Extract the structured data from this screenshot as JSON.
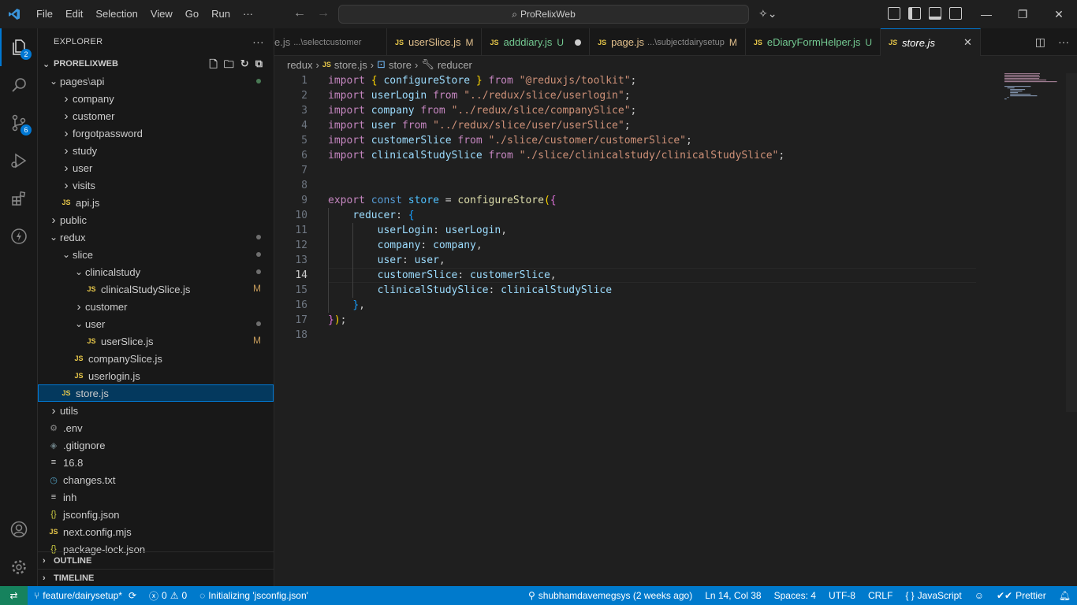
{
  "titlebar": {
    "menu": [
      "File",
      "Edit",
      "Selection",
      "View",
      "Go",
      "Run",
      "···"
    ],
    "search_text": "ProRelixWeb"
  },
  "activity": {
    "explorer_badge": "2",
    "scm_badge": "6"
  },
  "explorer": {
    "header": "EXPLORER",
    "more": "···",
    "project": "PRORELIXWEB",
    "tree": [
      {
        "label": "pages",
        "sub": "api",
        "depth": 1,
        "type": "folder-open",
        "marker": "dot-green"
      },
      {
        "label": "company",
        "depth": 2,
        "type": "folder"
      },
      {
        "label": "customer",
        "depth": 2,
        "type": "folder"
      },
      {
        "label": "forgotpassword",
        "depth": 2,
        "type": "folder"
      },
      {
        "label": "study",
        "depth": 2,
        "type": "folder"
      },
      {
        "label": "user",
        "depth": 2,
        "type": "folder"
      },
      {
        "label": "visits",
        "depth": 2,
        "type": "folder"
      },
      {
        "label": "api.js",
        "depth": 2,
        "type": "js"
      },
      {
        "label": "public",
        "depth": 1,
        "type": "folder"
      },
      {
        "label": "redux",
        "depth": 1,
        "type": "folder-open",
        "marker": "dot",
        "modified": true
      },
      {
        "label": "slice",
        "depth": 2,
        "type": "folder-open",
        "marker": "dot",
        "modified": true
      },
      {
        "label": "clinicalstudy",
        "depth": 3,
        "type": "folder-open",
        "marker": "dot",
        "modified": true
      },
      {
        "label": "clinicalStudySlice.js",
        "depth": 4,
        "type": "js",
        "marker": "M",
        "modified": true
      },
      {
        "label": "customer",
        "depth": 3,
        "type": "folder"
      },
      {
        "label": "user",
        "depth": 3,
        "type": "folder-open",
        "marker": "dot",
        "modified": true
      },
      {
        "label": "userSlice.js",
        "depth": 4,
        "type": "js",
        "marker": "M",
        "modified": true
      },
      {
        "label": "companySlice.js",
        "depth": 3,
        "type": "js"
      },
      {
        "label": "userlogin.js",
        "depth": 3,
        "type": "js"
      },
      {
        "label": "store.js",
        "depth": 2,
        "type": "js",
        "selected": true
      },
      {
        "label": "utils",
        "depth": 1,
        "type": "folder"
      },
      {
        "label": ".env",
        "depth": 1,
        "type": "gear"
      },
      {
        "label": ".gitignore",
        "depth": 1,
        "type": "git"
      },
      {
        "label": "16.8",
        "depth": 1,
        "type": "lines"
      },
      {
        "label": "changes.txt",
        "depth": 1,
        "type": "clock"
      },
      {
        "label": "inh",
        "depth": 1,
        "type": "lines"
      },
      {
        "label": "jsconfig.json",
        "depth": 1,
        "type": "json"
      },
      {
        "label": "next.config.mjs",
        "depth": 1,
        "type": "js"
      },
      {
        "label": "package-lock.json",
        "depth": 1,
        "type": "json"
      }
    ],
    "outline": "OUTLINE",
    "timeline": "TIMELINE"
  },
  "tabs": [
    {
      "name": "e.js",
      "desc": "...\\selectcustomer",
      "status": "",
      "icon": false
    },
    {
      "name": "userSlice.js",
      "desc": "",
      "status": "M",
      "icon": true,
      "color": "#e2c08d"
    },
    {
      "name": "adddiary.js",
      "desc": "",
      "status": "U",
      "icon": true,
      "color": "#73c991",
      "dot": true
    },
    {
      "name": "page.js",
      "desc": "...\\subjectdairysetup",
      "status": "M",
      "icon": true,
      "color": "#e2c08d"
    },
    {
      "name": "eDiaryFormHelper.js",
      "desc": "",
      "status": "U",
      "icon": true,
      "color": "#73c991"
    },
    {
      "name": "store.js",
      "desc": "",
      "status": "",
      "icon": true,
      "active": true
    }
  ],
  "breadcrumb": {
    "folder": "redux",
    "file": "store.js",
    "symbol": "store",
    "prop": "reducer"
  },
  "editor": {
    "current_line": 14,
    "lines": [
      [
        [
          "kw",
          "import"
        ],
        [
          "t",
          " "
        ],
        [
          "br1",
          "{"
        ],
        [
          "t",
          " "
        ],
        [
          "var",
          "configureStore"
        ],
        [
          "t",
          " "
        ],
        [
          "br1",
          "}"
        ],
        [
          "t",
          " "
        ],
        [
          "kw",
          "from"
        ],
        [
          "t",
          " "
        ],
        [
          "str",
          "\"@reduxjs/toolkit\""
        ],
        [
          "t",
          ";"
        ]
      ],
      [
        [
          "kw",
          "import"
        ],
        [
          "t",
          " "
        ],
        [
          "var",
          "userLogin"
        ],
        [
          "t",
          " "
        ],
        [
          "kw",
          "from"
        ],
        [
          "t",
          " "
        ],
        [
          "str",
          "\"../redux/slice/userlogin\""
        ],
        [
          "t",
          ";"
        ]
      ],
      [
        [
          "kw",
          "import"
        ],
        [
          "t",
          " "
        ],
        [
          "var",
          "company"
        ],
        [
          "t",
          " "
        ],
        [
          "kw",
          "from"
        ],
        [
          "t",
          " "
        ],
        [
          "str",
          "\"../redux/slice/companySlice\""
        ],
        [
          "t",
          ";"
        ]
      ],
      [
        [
          "kw",
          "import"
        ],
        [
          "t",
          " "
        ],
        [
          "var",
          "user"
        ],
        [
          "t",
          " "
        ],
        [
          "kw",
          "from"
        ],
        [
          "t",
          " "
        ],
        [
          "str",
          "\"../redux/slice/user/userSlice\""
        ],
        [
          "t",
          ";"
        ]
      ],
      [
        [
          "kw",
          "import"
        ],
        [
          "t",
          " "
        ],
        [
          "var",
          "customerSlice"
        ],
        [
          "t",
          " "
        ],
        [
          "kw",
          "from"
        ],
        [
          "t",
          " "
        ],
        [
          "str",
          "\"./slice/customer/customerSlice\""
        ],
        [
          "t",
          ";"
        ]
      ],
      [
        [
          "kw",
          "import"
        ],
        [
          "t",
          " "
        ],
        [
          "var",
          "clinicalStudySlice"
        ],
        [
          "t",
          " "
        ],
        [
          "kw",
          "from"
        ],
        [
          "t",
          " "
        ],
        [
          "str",
          "\"./slice/clinicalstudy/clinicalStudySlice\""
        ],
        [
          "t",
          ";"
        ]
      ],
      [],
      [],
      [
        [
          "kw",
          "export"
        ],
        [
          "t",
          " "
        ],
        [
          "blue",
          "const"
        ],
        [
          "t",
          " "
        ],
        [
          "cvar",
          "store"
        ],
        [
          "t",
          " = "
        ],
        [
          "fn",
          "configureStore"
        ],
        [
          "br1",
          "("
        ],
        [
          "br2",
          "{"
        ]
      ],
      [
        [
          "t",
          "    "
        ],
        [
          "var",
          "reducer"
        ],
        [
          "t",
          ": "
        ],
        [
          "br3",
          "{"
        ]
      ],
      [
        [
          "t",
          "        "
        ],
        [
          "var",
          "userLogin"
        ],
        [
          "t",
          ": "
        ],
        [
          "var",
          "userLogin"
        ],
        [
          "t",
          ","
        ]
      ],
      [
        [
          "t",
          "        "
        ],
        [
          "var",
          "company"
        ],
        [
          "t",
          ": "
        ],
        [
          "var",
          "company"
        ],
        [
          "t",
          ","
        ]
      ],
      [
        [
          "t",
          "        "
        ],
        [
          "var",
          "user"
        ],
        [
          "t",
          ": "
        ],
        [
          "var",
          "user"
        ],
        [
          "t",
          ","
        ]
      ],
      [
        [
          "t",
          "        "
        ],
        [
          "var",
          "customerSlice"
        ],
        [
          "t",
          ": "
        ],
        [
          "var",
          "customerSlice"
        ],
        [
          "t",
          ","
        ]
      ],
      [
        [
          "t",
          "        "
        ],
        [
          "var",
          "clinicalStudySlice"
        ],
        [
          "t",
          ": "
        ],
        [
          "var",
          "clinicalStudySlice"
        ]
      ],
      [
        [
          "t",
          "    "
        ],
        [
          "br3",
          "}"
        ],
        [
          "t",
          ","
        ]
      ],
      [
        [
          "br2",
          "}"
        ],
        [
          "br1",
          ")"
        ],
        [
          "t",
          ";"
        ]
      ],
      []
    ]
  },
  "statusbar": {
    "branch": "feature/dairysetup*",
    "errors": "0",
    "warnings": "0",
    "message": "Initializing 'jsconfig.json'",
    "blame": "shubhamdavemegsys (2 weeks ago)",
    "position": "Ln 14, Col 38",
    "spaces": "Spaces: 4",
    "encoding": "UTF-8",
    "eol": "CRLF",
    "language": "JavaScript",
    "prettier": "Prettier"
  },
  "colors": {
    "accent": "#0078d4",
    "statusbar": "#007acc",
    "remote": "#16825d"
  }
}
